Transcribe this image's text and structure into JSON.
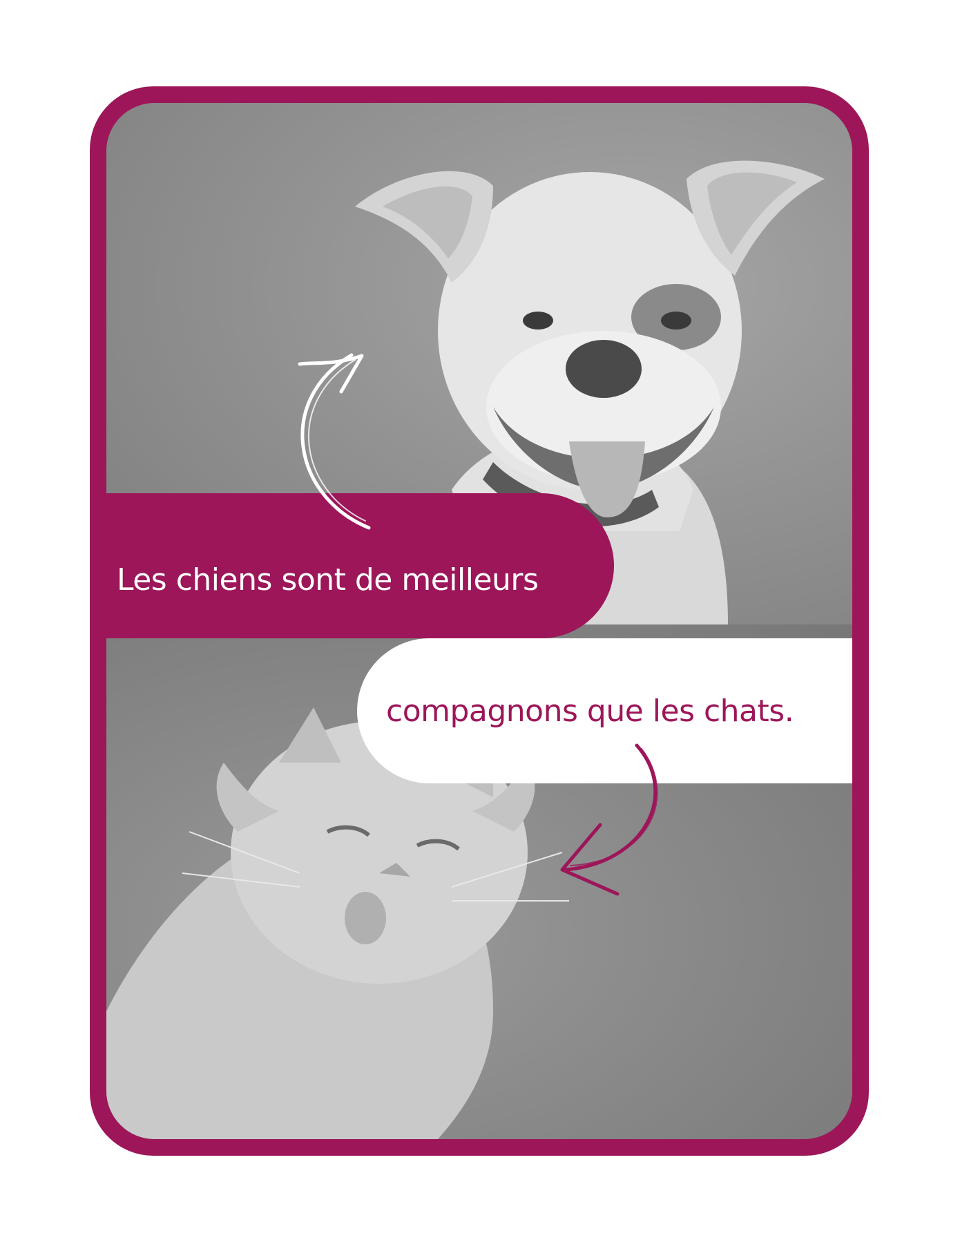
{
  "card": {
    "frame_color": "#9c1659",
    "top_photo": "dog-photo",
    "bottom_photo": "cat-photo"
  },
  "banner_top": {
    "text": "Les chiens sont de meilleurs",
    "background": "#9c1659",
    "text_color": "#ffffff"
  },
  "banner_bottom": {
    "text": "compagnons que les chats.",
    "background": "#ffffff",
    "text_color": "#9c1659"
  },
  "arrows": {
    "top_arrow_icon": "curved-arrow-up-icon",
    "top_arrow_color": "#ffffff",
    "bottom_arrow_icon": "curved-arrow-left-icon",
    "bottom_arrow_color": "#9c1659"
  }
}
